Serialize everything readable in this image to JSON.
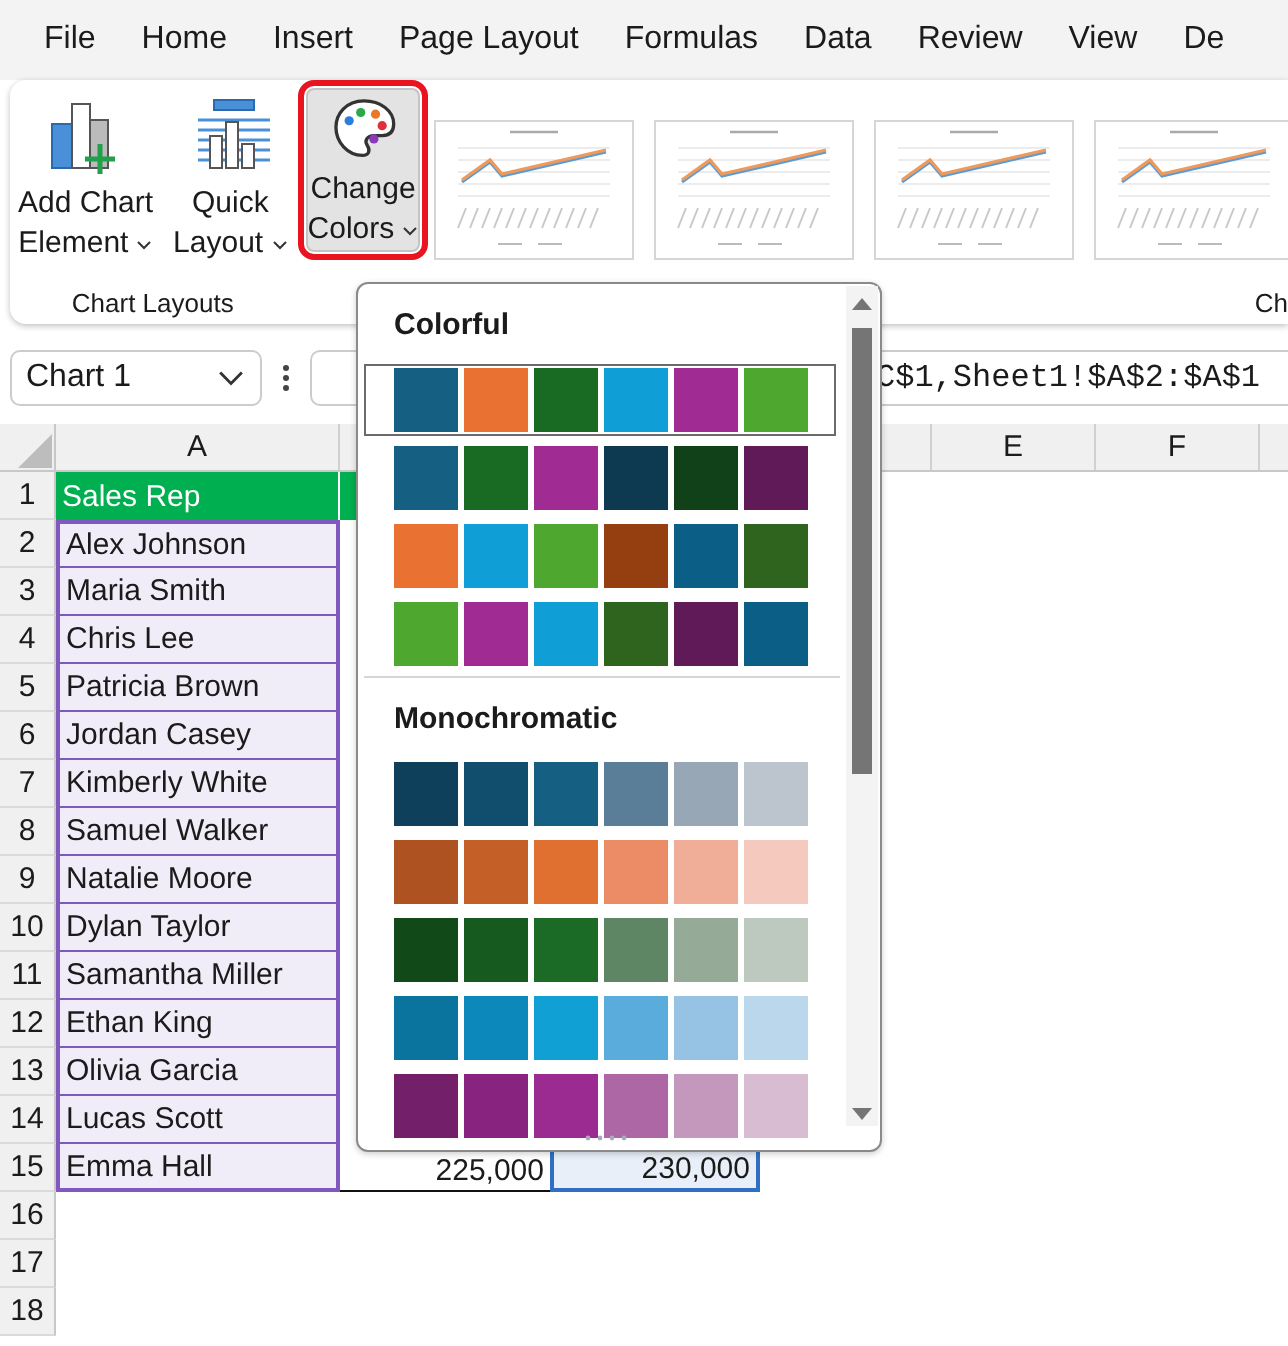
{
  "menu_tabs": [
    "File",
    "Home",
    "Insert",
    "Page Layout",
    "Formulas",
    "Data",
    "Review",
    "View",
    "De"
  ],
  "ribbon": {
    "chart_layouts": {
      "label": "Chart Layouts",
      "buttons": [
        {
          "kind": "add-element",
          "line1": "Add Chart",
          "line2": "Element"
        },
        {
          "kind": "quick-layout",
          "line1": "Quick",
          "line2": "Layout"
        }
      ]
    },
    "change_colors": {
      "line1": "Change",
      "line2": "Colors",
      "highlighted": true
    },
    "next_group_label": "Ch"
  },
  "name_box": {
    "value": "Chart 1"
  },
  "formula": "C$1,Sheet1!$A$2:$A$1",
  "columns": [
    {
      "label": "A"
    },
    {},
    {},
    {},
    {
      "label": "E"
    },
    {
      "label": "F"
    }
  ],
  "rows": [
    {
      "number": "1",
      "cells": [
        {
          "text": "Sales Rep",
          "kind": "header"
        },
        {
          "kind": "header"
        }
      ]
    },
    {
      "number": "2",
      "cells": [
        {
          "text": "Alex Johnson",
          "color": "#8157c0"
        }
      ]
    },
    {
      "number": "3",
      "cells": [
        {
          "text": "Maria Smith",
          "color": "#8157c0"
        }
      ]
    },
    {
      "number": "4",
      "cells": [
        {
          "text": "Chris Lee",
          "color": "#8157c0"
        }
      ]
    },
    {
      "number": "5",
      "cells": [
        {
          "text": "Patricia Brown",
          "color": "#8157c0"
        }
      ]
    },
    {
      "number": "6",
      "cells": [
        {
          "text": "Jordan Casey",
          "color": "#8157c0"
        }
      ]
    },
    {
      "number": "7",
      "cells": [
        {
          "text": "Kimberly White",
          "color": "#8157c0"
        }
      ]
    },
    {
      "number": "8",
      "cells": [
        {
          "text": "Samuel Walker",
          "color": "#8157c0"
        }
      ]
    },
    {
      "number": "9",
      "cells": [
        {
          "text": "Natalie Moore",
          "color": "#8157c0"
        }
      ]
    },
    {
      "number": "10",
      "cells": [
        {
          "text": "Dylan Taylor",
          "color": "#8157c0"
        }
      ]
    },
    {
      "number": "11",
      "cells": [
        {
          "text": "Samantha Miller",
          "color": "#8157c0"
        }
      ]
    },
    {
      "number": "12",
      "cells": [
        {
          "text": "Ethan King",
          "color": "#8157c0"
        }
      ]
    },
    {
      "number": "13",
      "cells": [
        {
          "text": "Olivia Garcia",
          "color": "#8157c0"
        }
      ]
    },
    {
      "number": "14",
      "cells": [
        {
          "text": "Lucas Scott",
          "color": "#8157c0"
        }
      ]
    },
    {
      "number": "15",
      "cells": [
        {
          "text": "Emma Hall",
          "color": "#8157c0"
        },
        {
          "text": "225,000",
          "kind": "number"
        },
        {
          "text": "230,000",
          "kind": "number",
          "color": "#2f6fc4"
        }
      ]
    },
    {
      "number": "16"
    },
    {
      "number": "17"
    },
    {
      "number": "18"
    }
  ],
  "color_menu": {
    "sections": [
      {
        "title": "Colorful",
        "rows": [
          {
            "selected": true,
            "swatches": [
              {
                "color": "#156082"
              },
              {
                "color": "#e97132"
              },
              {
                "color": "#196b24"
              },
              {
                "color": "#0f9ed5"
              },
              {
                "color": "#a02b93"
              },
              {
                "color": "#4ea72e"
              }
            ]
          },
          {
            "selected": false,
            "swatches": [
              {
                "color": "#156082"
              },
              {
                "color": "#196b24"
              },
              {
                "color": "#a02b93"
              },
              {
                "color": "#0e3a51"
              },
              {
                "color": "#104119"
              },
              {
                "color": "#601a58"
              }
            ]
          },
          {
            "selected": false,
            "swatches": [
              {
                "color": "#e97132"
              },
              {
                "color": "#0f9ed5"
              },
              {
                "color": "#4ea72e"
              },
              {
                "color": "#953f10"
              },
              {
                "color": "#0b5f86"
              },
              {
                "color": "#2f641e"
              }
            ]
          },
          {
            "selected": false,
            "swatches": [
              {
                "color": "#4ea72e"
              },
              {
                "color": "#a02b93"
              },
              {
                "color": "#0f9ed5"
              },
              {
                "color": "#2f641e"
              },
              {
                "color": "#601a58"
              },
              {
                "color": "#0b5f86"
              }
            ]
          }
        ]
      },
      {
        "title": "Monochromatic",
        "rows": [
          {
            "selected": false,
            "swatches": [
              {
                "color": "#0e3f5b"
              },
              {
                "color": "#114e6d"
              },
              {
                "color": "#156082"
              },
              {
                "color": "#5b7e98"
              },
              {
                "color": "#97a7b6"
              },
              {
                "color": "#bcc4cd"
              }
            ]
          },
          {
            "selected": false,
            "swatches": [
              {
                "color": "#ae5222"
              },
              {
                "color": "#c55f28"
              },
              {
                "color": "#e0702f"
              },
              {
                "color": "#ec8c67"
              },
              {
                "color": "#f0ae99"
              },
              {
                "color": "#f5c9be"
              }
            ]
          },
          {
            "selected": false,
            "swatches": [
              {
                "color": "#114919"
              },
              {
                "color": "#165a20"
              },
              {
                "color": "#1b6a26"
              },
              {
                "color": "#5e8564"
              },
              {
                "color": "#96ab97"
              },
              {
                "color": "#bdc8bf"
              }
            ]
          },
          {
            "selected": false,
            "swatches": [
              {
                "color": "#0a739e"
              },
              {
                "color": "#0d88bb"
              },
              {
                "color": "#10a0d3"
              },
              {
                "color": "#59acdc"
              },
              {
                "color": "#96c3e4"
              },
              {
                "color": "#bad7ec"
              }
            ]
          },
          {
            "selected": false,
            "swatches": [
              {
                "color": "#741f6a"
              },
              {
                "color": "#882480"
              },
              {
                "color": "#9b2b91"
              },
              {
                "color": "#ae67a5"
              },
              {
                "color": "#c498bd"
              },
              {
                "color": "#d7bcd2"
              }
            ]
          }
        ]
      }
    ]
  }
}
